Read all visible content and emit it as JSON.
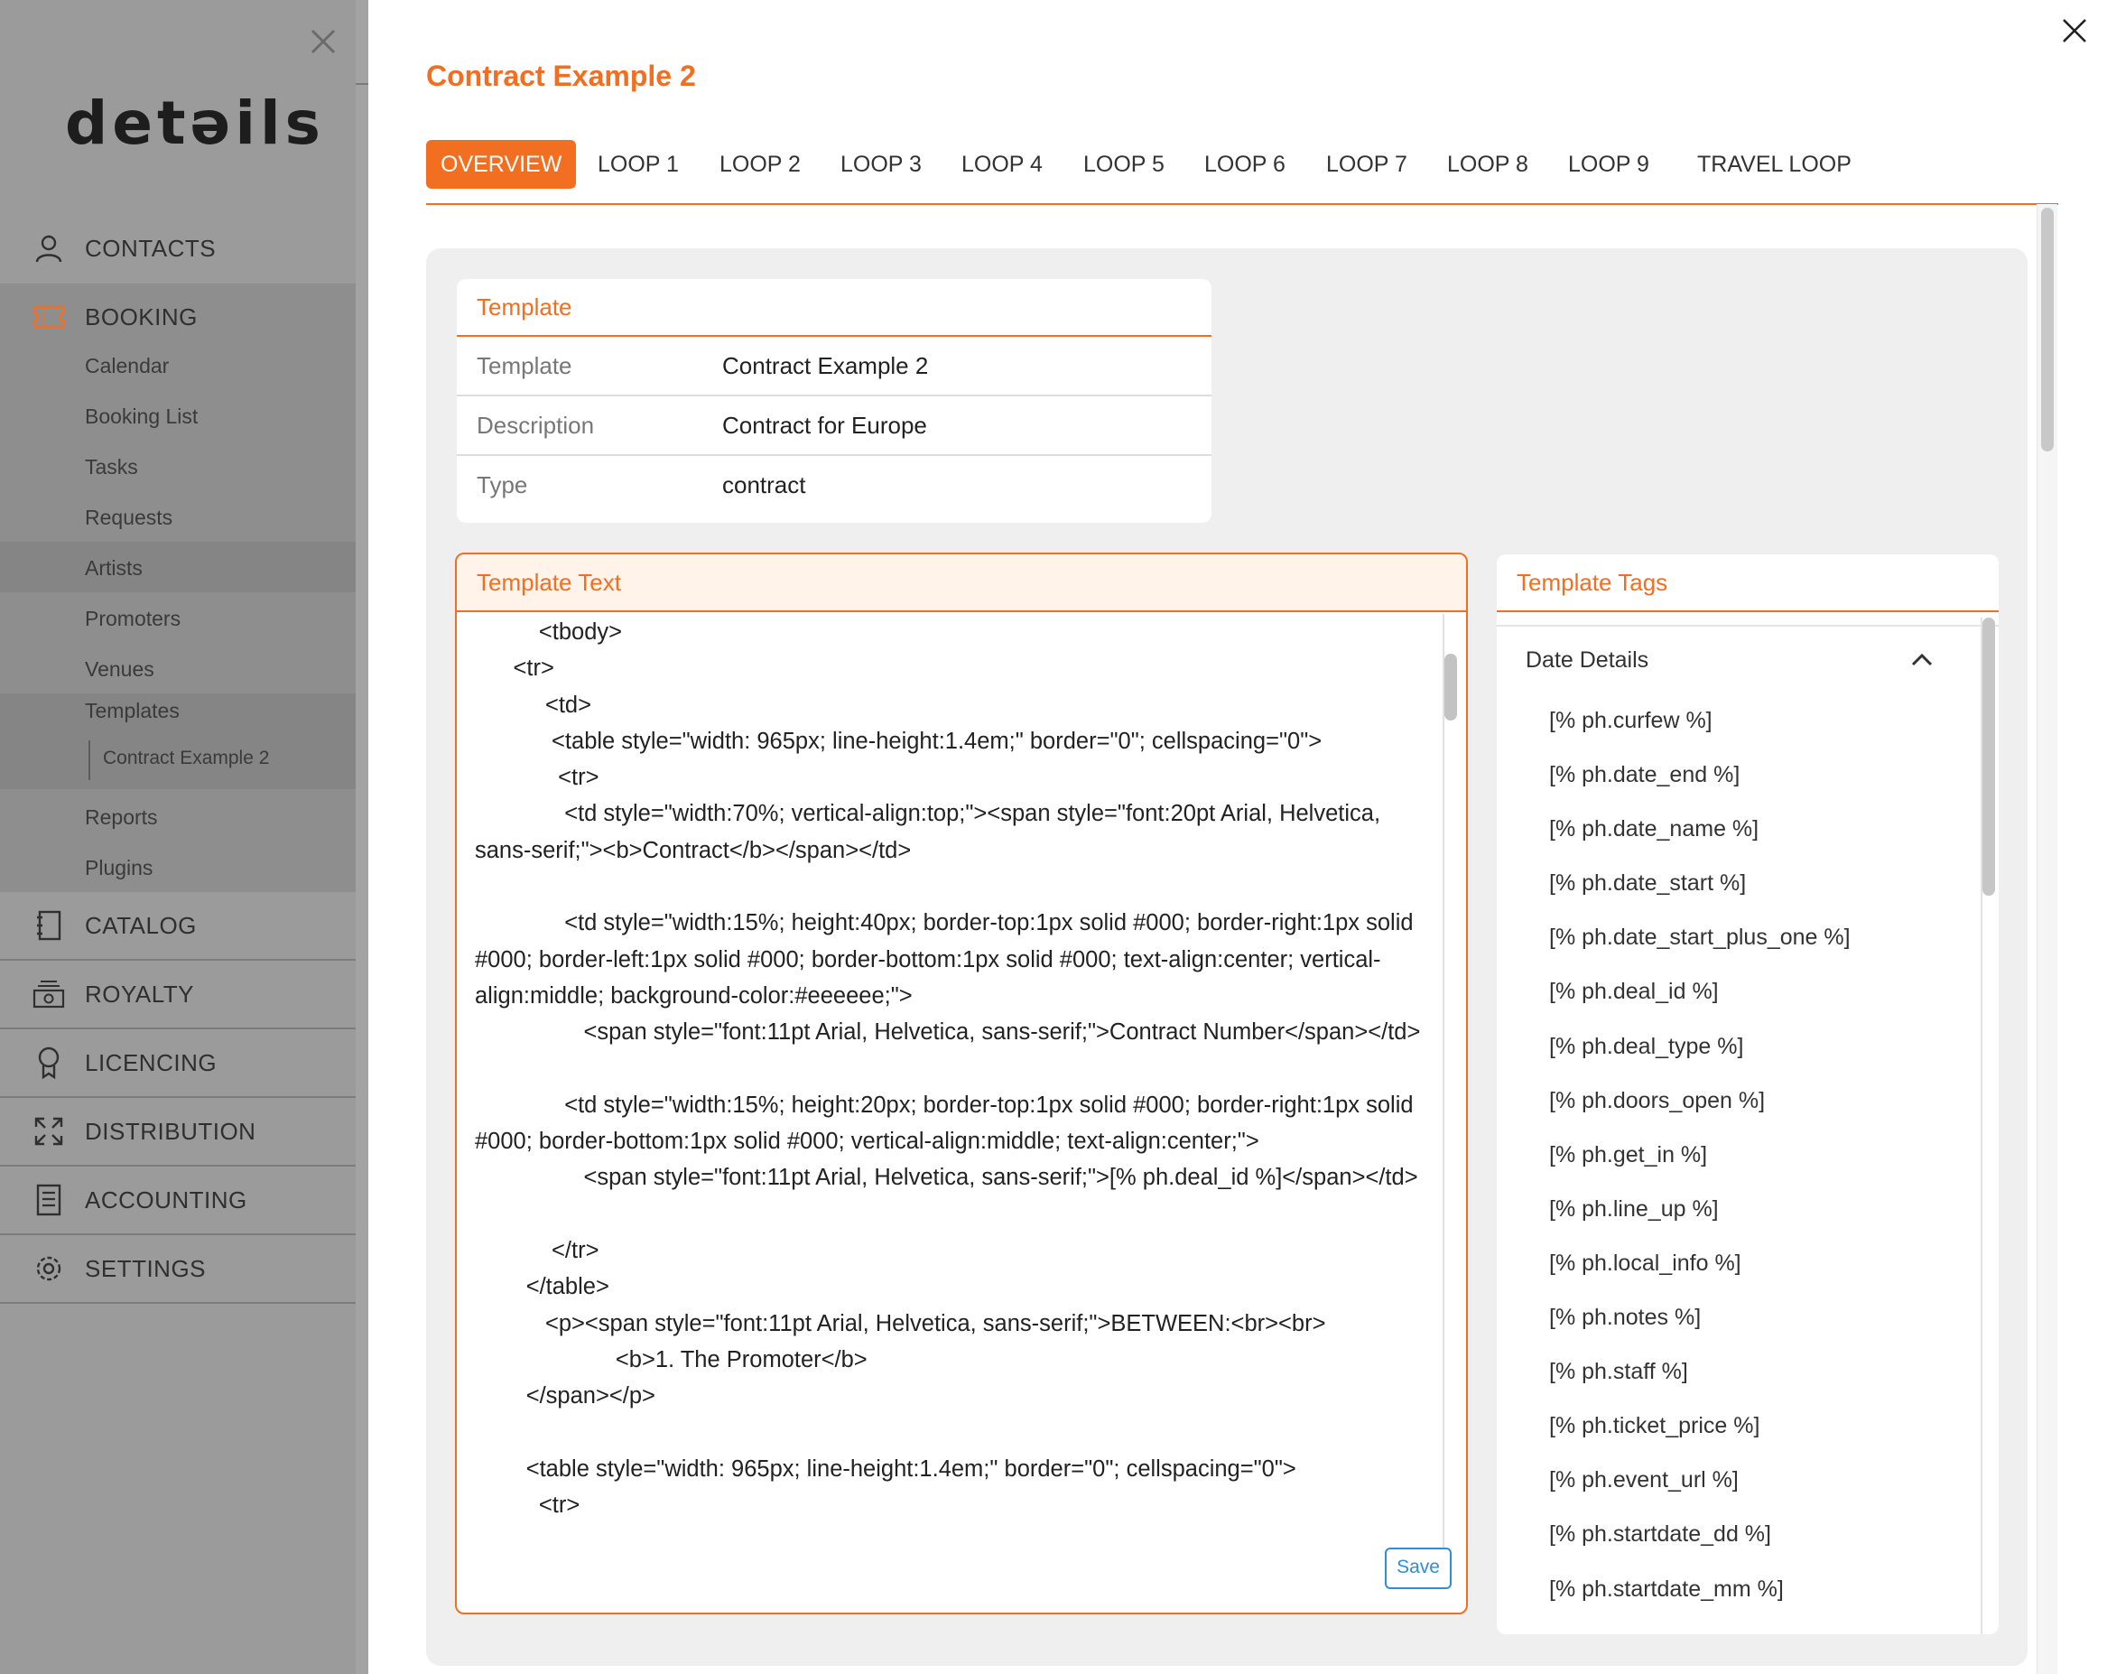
{
  "sidebar": {
    "logo": "detəils",
    "nav": [
      {
        "label": "CONTACTS",
        "icon": "person-icon"
      },
      {
        "label": "BOOKING",
        "icon": "ticket-icon"
      },
      {
        "label": "CATALOG",
        "icon": "catalog-icon"
      },
      {
        "label": "ROYALTY",
        "icon": "money-icon"
      },
      {
        "label": "LICENCING",
        "icon": "award-icon"
      },
      {
        "label": "DISTRIBUTION",
        "icon": "expand-arrows-icon"
      },
      {
        "label": "ACCOUNTING",
        "icon": "document-icon"
      },
      {
        "label": "SETTINGS",
        "icon": "gear-icon"
      }
    ],
    "booking_sub": [
      "Calendar",
      "Booking List",
      "Tasks",
      "Requests",
      "Artists",
      "Promoters",
      "Venues",
      "Templates"
    ],
    "templates_child": "Contract Example 2",
    "after_sub": [
      "Reports",
      "Plugins"
    ]
  },
  "modal": {
    "title": "Contract Example 2",
    "tabs": [
      "OVERVIEW",
      "LOOP 1",
      "LOOP 2",
      "LOOP 3",
      "LOOP 4",
      "LOOP 5",
      "LOOP 6",
      "LOOP 7",
      "LOOP 8",
      "LOOP 9",
      "TRAVEL LOOP"
    ],
    "active_tab": "OVERVIEW",
    "template_card": {
      "title": "Template",
      "rows": [
        {
          "key": "Template",
          "value": "Contract Example 2"
        },
        {
          "key": "Description",
          "value": "Contract for Europe"
        },
        {
          "key": "Type",
          "value": "contract"
        }
      ]
    },
    "template_text": {
      "title": "Template Text",
      "code": "          <tbody>\n      <tr>\n           <td>\n            <table style=\"width: 965px; line-height:1.4em;\" border=\"0\"; cellspacing=\"0\">\n             <tr>\n              <td style=\"width:70%; vertical-align:top;\"><span style=\"font:20pt Arial, Helvetica, sans-serif;\"><b>Contract</b></span></td>\n\n              <td style=\"width:15%; height:40px; border-top:1px solid #000; border-right:1px solid #000; border-left:1px solid #000; border-bottom:1px solid #000; text-align:center; vertical-align:middle; background-color:#eeeeee;\">\n                 <span style=\"font:11pt Arial, Helvetica, sans-serif;\">Contract Number</span></td>\n\n              <td style=\"width:15%; height:20px; border-top:1px solid #000; border-right:1px solid #000; border-bottom:1px solid #000; vertical-align:middle; text-align:center;\">\n                 <span style=\"font:11pt Arial, Helvetica, sans-serif;\">[% ph.deal_id %]</span></td>\n\n            </tr>\n        </table>\n           <p><span style=\"font:11pt Arial, Helvetica, sans-serif;\">BETWEEN:<br><br>\n                      <b>1. The Promoter</b>\n        </span></p>\n\n        <table style=\"width: 965px; line-height:1.4em;\" border=\"0\"; cellspacing=\"0\">\n          <tr>",
      "save_label": "Save"
    },
    "template_tags": {
      "title": "Template Tags",
      "group": "Date Details",
      "tags": [
        "[% ph.curfew %]",
        "[% ph.date_end %]",
        "[% ph.date_name %]",
        "[% ph.date_start %]",
        "[% ph.date_start_plus_one %]",
        "[% ph.deal_id %]",
        "[% ph.deal_type %]",
        "[% ph.doors_open %]",
        "[% ph.get_in %]",
        "[% ph.line_up %]",
        "[% ph.local_info %]",
        "[% ph.notes %]",
        "[% ph.staff %]",
        "[% ph.ticket_price %]",
        "[% ph.event_url %]",
        "[% ph.startdate_dd %]",
        "[% ph.startdate_mm %]"
      ]
    }
  },
  "colors": {
    "accent": "#f26f21",
    "save_blue": "#2f8fd6",
    "sidebar_dim": "#9b9b9b"
  }
}
